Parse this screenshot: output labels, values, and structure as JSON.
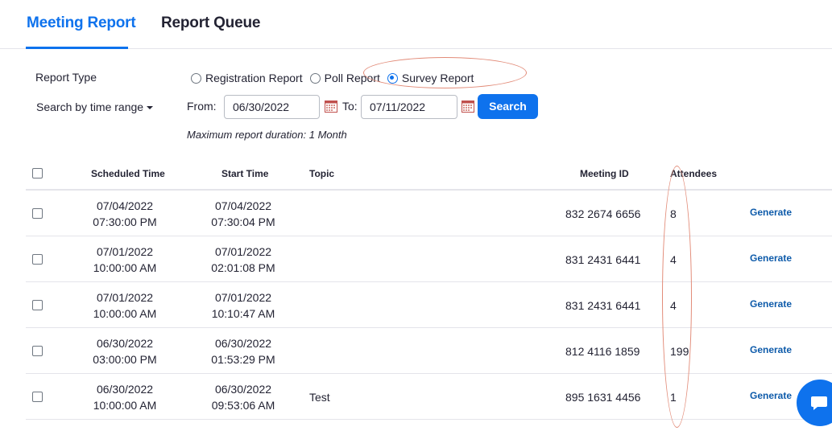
{
  "tabs": [
    {
      "label": "Meeting Report",
      "active": true
    },
    {
      "label": "Report Queue",
      "active": false
    }
  ],
  "filters": {
    "report_type_label": "Report Type",
    "report_types": [
      {
        "label": "Registration Report",
        "checked": false
      },
      {
        "label": "Poll Report",
        "checked": false
      },
      {
        "label": "Survey Report",
        "checked": true
      }
    ],
    "search_mode_label": "Search by time range",
    "from_label": "From:",
    "from_value": "06/30/2022",
    "to_label": "To:",
    "to_value": "07/11/2022",
    "search_label": "Search",
    "max_duration_note": "Maximum report duration: 1 Month"
  },
  "table": {
    "headers": {
      "scheduled_time": "Scheduled Time",
      "start_time": "Start Time",
      "topic": "Topic",
      "meeting_id": "Meeting ID",
      "attendees": "Attendees"
    },
    "rows": [
      {
        "sched_date": "07/04/2022",
        "sched_time": "07:30:00 PM",
        "start_date": "07/04/2022",
        "start_time": "07:30:04 PM",
        "topic": "",
        "meeting_id": "832 2674 6656",
        "attendees": "8",
        "action": "Generate"
      },
      {
        "sched_date": "07/01/2022",
        "sched_time": "10:00:00 AM",
        "start_date": "07/01/2022",
        "start_time": "02:01:08 PM",
        "topic": "",
        "meeting_id": "831 2431 6441",
        "attendees": "4",
        "action": "Generate"
      },
      {
        "sched_date": "07/01/2022",
        "sched_time": "10:00:00 AM",
        "start_date": "07/01/2022",
        "start_time": "10:10:47 AM",
        "topic": "",
        "meeting_id": "831 2431 6441",
        "attendees": "4",
        "action": "Generate"
      },
      {
        "sched_date": "06/30/2022",
        "sched_time": "03:00:00 PM",
        "start_date": "06/30/2022",
        "start_time": "01:53:29 PM",
        "topic": "",
        "meeting_id": "812 4116 1859",
        "attendees": "199",
        "action": "Generate"
      },
      {
        "sched_date": "06/30/2022",
        "sched_time": "10:00:00 AM",
        "start_date": "06/30/2022",
        "start_time": "09:53:06 AM",
        "topic": "Test",
        "meeting_id": "895 1631 4456",
        "attendees": "1",
        "action": "Generate"
      }
    ]
  },
  "icons": {
    "calendar": "calendar-icon",
    "chat": "chat-bubble-icon",
    "caret": "caret-down-icon"
  },
  "colors": {
    "accent": "#0e72ed",
    "link": "#0e5baa",
    "annotation": "#e28b78"
  }
}
